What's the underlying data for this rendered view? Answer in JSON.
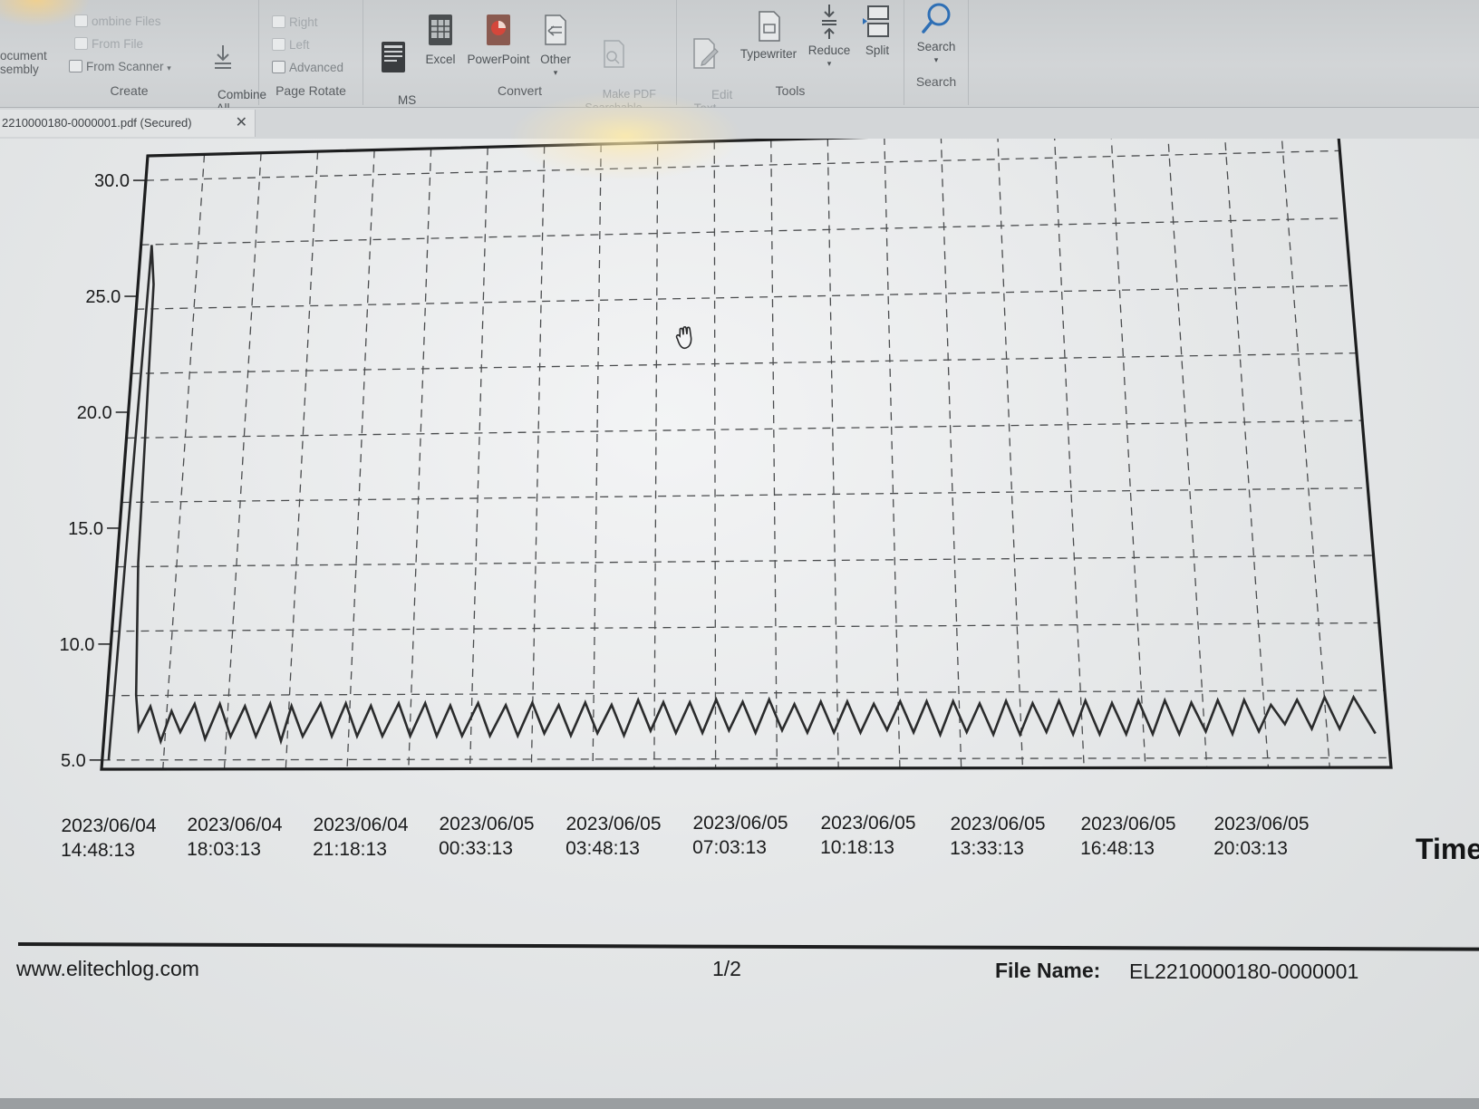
{
  "ribbon": {
    "create": {
      "label": "Create",
      "document_assembly": "ocument\nsembly",
      "combine_files": "ombine Files",
      "from_file": "From File",
      "from_scanner": "From Scanner",
      "combine_all": "Combine\nAll"
    },
    "page_rotate": {
      "label": "Page Rotate",
      "right": "Right",
      "left": "Left",
      "advanced": "Advanced"
    },
    "convert": {
      "label": "Convert",
      "ms_word": "MS\nWord",
      "excel": "Excel",
      "powerpoint": "PowerPoint",
      "other": "Other",
      "make_pdf_searchable": "Make PDF\nSearchable"
    },
    "tools": {
      "label": "Tools",
      "edit_text": "Edit\nText",
      "typewriter": "Typewriter",
      "reduce": "Reduce",
      "split": "Split"
    },
    "search": {
      "label": "Search",
      "search": "Search"
    }
  },
  "document_tab": {
    "title": "2210000180-0000001.pdf (Secured)",
    "close": "✕"
  },
  "chart_data": {
    "type": "line",
    "title": "",
    "xlabel": "Time",
    "ylabel": "",
    "ylim": [
      5.0,
      30.0
    ],
    "y_ticks": [
      "30.0",
      "25.0",
      "20.0",
      "15.0",
      "10.0",
      "5.0"
    ],
    "x_ticks": [
      {
        "date": "2023/06/04",
        "time": "14:48:13"
      },
      {
        "date": "2023/06/04",
        "time": "18:03:13"
      },
      {
        "date": "2023/06/04",
        "time": "21:18:13"
      },
      {
        "date": "2023/06/05",
        "time": "00:33:13"
      },
      {
        "date": "2023/06/05",
        "time": "03:48:13"
      },
      {
        "date": "2023/06/05",
        "time": "07:03:13"
      },
      {
        "date": "2023/06/05",
        "time": "10:18:13"
      },
      {
        "date": "2023/06/05",
        "time": "13:33:13"
      },
      {
        "date": "2023/06/05",
        "time": "16:48:13"
      },
      {
        "date": "2023/06/05",
        "time": "20:03:13"
      }
    ],
    "grid": true,
    "series": [
      {
        "values": [
          [
            0.0,
            5.0
          ],
          [
            0.004,
            27.2
          ],
          [
            0.008,
            25.5
          ],
          [
            0.012,
            13.5
          ],
          [
            0.018,
            7.8
          ],
          [
            0.022,
            6.3
          ],
          [
            0.03,
            7.3
          ],
          [
            0.04,
            5.8
          ],
          [
            0.047,
            7.1
          ],
          [
            0.055,
            6.2
          ],
          [
            0.065,
            7.4
          ],
          [
            0.075,
            5.9
          ],
          [
            0.085,
            7.4
          ],
          [
            0.095,
            6.0
          ],
          [
            0.105,
            7.3
          ],
          [
            0.115,
            6.0
          ],
          [
            0.125,
            7.4
          ],
          [
            0.135,
            5.8
          ],
          [
            0.142,
            7.3
          ],
          [
            0.152,
            6.0
          ],
          [
            0.165,
            7.4
          ],
          [
            0.175,
            6.0
          ],
          [
            0.185,
            7.4
          ],
          [
            0.195,
            6.0
          ],
          [
            0.205,
            7.3
          ],
          [
            0.215,
            6.0
          ],
          [
            0.227,
            7.4
          ],
          [
            0.237,
            6.0
          ],
          [
            0.248,
            7.4
          ],
          [
            0.258,
            6.0
          ],
          [
            0.268,
            7.3
          ],
          [
            0.278,
            6.0
          ],
          [
            0.29,
            7.4
          ],
          [
            0.3,
            6.0
          ],
          [
            0.312,
            7.3
          ],
          [
            0.322,
            6.0
          ],
          [
            0.333,
            7.4
          ],
          [
            0.343,
            6.1
          ],
          [
            0.354,
            7.3
          ],
          [
            0.364,
            6.0
          ],
          [
            0.375,
            7.4
          ],
          [
            0.385,
            6.1
          ],
          [
            0.396,
            7.3
          ],
          [
            0.406,
            6.0
          ],
          [
            0.417,
            7.5
          ],
          [
            0.427,
            6.2
          ],
          [
            0.437,
            7.4
          ],
          [
            0.447,
            6.1
          ],
          [
            0.458,
            7.4
          ],
          [
            0.468,
            6.1
          ],
          [
            0.479,
            7.5
          ],
          [
            0.489,
            6.2
          ],
          [
            0.5,
            7.4
          ],
          [
            0.51,
            6.1
          ],
          [
            0.521,
            7.5
          ],
          [
            0.531,
            6.2
          ],
          [
            0.541,
            7.3
          ],
          [
            0.551,
            6.1
          ],
          [
            0.562,
            7.4
          ],
          [
            0.572,
            6.1
          ],
          [
            0.583,
            7.4
          ],
          [
            0.593,
            6.1
          ],
          [
            0.604,
            7.3
          ],
          [
            0.614,
            6.2
          ],
          [
            0.625,
            7.4
          ],
          [
            0.635,
            6.1
          ],
          [
            0.646,
            7.4
          ],
          [
            0.656,
            6.0
          ],
          [
            0.667,
            7.4
          ],
          [
            0.677,
            6.1
          ],
          [
            0.688,
            7.3
          ],
          [
            0.698,
            6.0
          ],
          [
            0.709,
            7.4
          ],
          [
            0.719,
            6.0
          ],
          [
            0.73,
            7.3
          ],
          [
            0.74,
            6.1
          ],
          [
            0.751,
            7.4
          ],
          [
            0.761,
            6.0
          ],
          [
            0.772,
            7.4
          ],
          [
            0.782,
            6.0
          ],
          [
            0.793,
            7.3
          ],
          [
            0.803,
            6.0
          ],
          [
            0.814,
            7.4
          ],
          [
            0.824,
            6.0
          ],
          [
            0.835,
            7.4
          ],
          [
            0.845,
            6.0
          ],
          [
            0.856,
            7.3
          ],
          [
            0.866,
            6.1
          ],
          [
            0.877,
            7.4
          ],
          [
            0.887,
            6.0
          ],
          [
            0.898,
            7.4
          ],
          [
            0.908,
            6.1
          ],
          [
            0.919,
            7.2
          ],
          [
            0.929,
            6.4
          ],
          [
            0.94,
            7.4
          ],
          [
            0.95,
            6.2
          ],
          [
            0.962,
            7.5
          ],
          [
            0.972,
            6.2
          ],
          [
            0.985,
            7.5
          ],
          [
            1.0,
            6.0
          ]
        ]
      }
    ]
  },
  "footer": {
    "website": "www.elitechlog.com",
    "page": "1/2",
    "file_name_label": "File Name:",
    "file_name_value": "EL2210000180-0000001"
  },
  "colors": {
    "line": "#2a2b2c",
    "grid": "#4a4c4e",
    "frame": "#1d1e1f",
    "ribbon_bg": "#cdd0d2"
  },
  "icons": {
    "combine": "download-arrow-icon",
    "rotate_right": "rotate-right-icon",
    "rotate_left": "rotate-left-icon",
    "ms_word": "word-icon",
    "excel": "excel-icon",
    "powerpoint": "powerpoint-icon",
    "other": "document-icon",
    "edit_text": "edit-text-icon",
    "typewriter": "typewriter-icon",
    "reduce": "reduce-icon",
    "split": "split-icon",
    "search": "search-icon",
    "cursor": "hand-cursor-icon"
  }
}
